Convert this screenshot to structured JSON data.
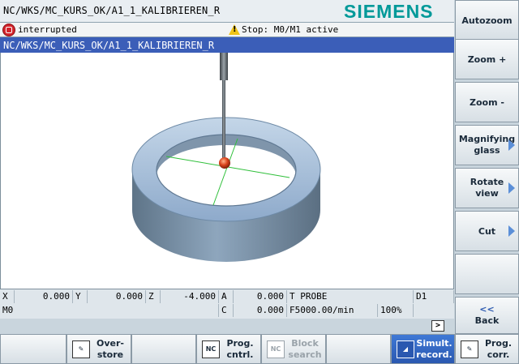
{
  "program_path": "NC/WKS/MC_KURS_OK/A1_1_KALIBRIEREN_R",
  "brand": "SIEMENS",
  "status": {
    "channel_state": "interrupted",
    "message": "Stop: M0/M1 active"
  },
  "program_bar": "NC/WKS/MC_KURS_OK/A1_1_KALIBRIEREN_R",
  "dro": {
    "x_label": "X",
    "x_value": "0.000",
    "y_label": "Y",
    "y_value": "0.000",
    "z_label": "Z",
    "z_value": "-4.000",
    "a_label": "A",
    "a_value": "0.000",
    "tool": "T PROBE",
    "d": "D1",
    "m_code": "M0",
    "c_label": "C",
    "c_value": "0.000",
    "feed": "F5000.00/min",
    "override": "100%",
    "more": ">"
  },
  "softkeys": {
    "autozoom": "Autozoom",
    "zoom_in": "Zoom +",
    "zoom_out": "Zoom -",
    "magnifying_1": "Magnifying",
    "magnifying_2": "glass",
    "rotate_1": "Rotate",
    "rotate_2": "view",
    "cut": "Cut",
    "back_symbol": "<<",
    "back": "Back"
  },
  "hkeys": {
    "overstore_1": "Over-",
    "overstore_2": "store",
    "progctrl_1": "Prog.",
    "progctrl_2": "cntrl.",
    "blocksearch_1": "Block",
    "blocksearch_2": "search",
    "simrecord_1": "Simult.",
    "simrecord_2": "record.",
    "progcorr_1": "Prog.",
    "progcorr_2": "corr."
  },
  "colors": {
    "brand": "#009999",
    "program_bar": "#3b5eb8",
    "ring": "#9fb6cf",
    "probe_ball": "#d9431c",
    "axis": "#2fbf3a"
  }
}
